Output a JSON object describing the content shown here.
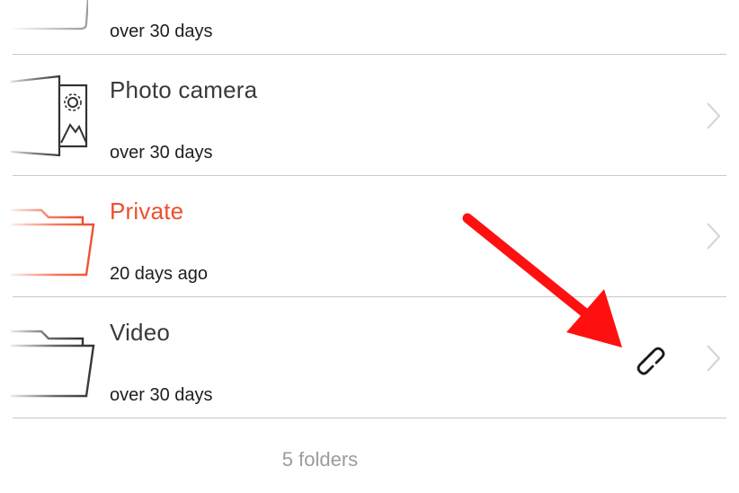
{
  "rows": [
    {
      "name": "",
      "meta": "over 30 days",
      "icon": "folder-icon"
    },
    {
      "name": "Photo camera",
      "meta": "over 30 days",
      "icon": "photo-camera-folder-icon"
    },
    {
      "name": "Private",
      "meta": "20 days ago",
      "icon": "folder-icon"
    },
    {
      "name": "Video",
      "meta": "over 30 days",
      "icon": "folder-icon"
    }
  ],
  "footer": {
    "count_text": "5 folders"
  },
  "colors": {
    "accent": "#ee4f2e",
    "arrow": "#ff1010",
    "text": "#3a3a3a",
    "muted": "#9c9c9c",
    "divider": "#c9c9c9"
  },
  "icons": {
    "shared_link": "link-icon",
    "disclosure": "chevron-right-icon",
    "annotation": "red-arrow-annotation"
  }
}
